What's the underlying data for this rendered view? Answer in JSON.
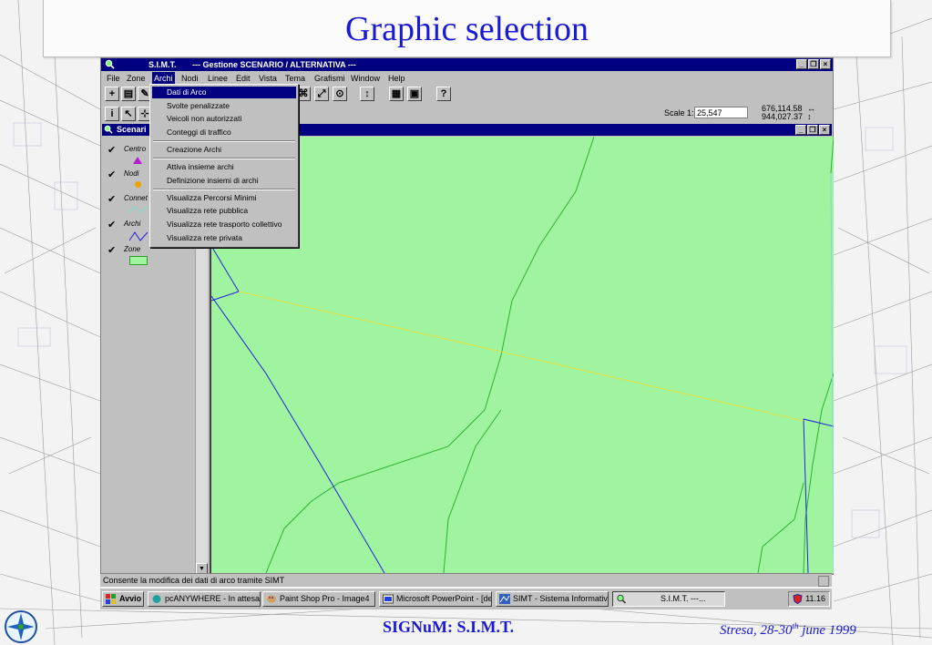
{
  "slide": {
    "title": "Graphic selection",
    "footer_center": "SIGNuM: S.I.M.T.",
    "footer_place_date_pre": "Stresa, 28-30",
    "footer_place_date_sup": "th",
    "footer_place_date_post": " june 1999"
  },
  "window": {
    "app_name": "S.I.M.T.",
    "title": "--- Gestione SCENARIO / ALTERNATIVA ---",
    "min": "_",
    "max": "❐",
    "close": "×"
  },
  "menu": [
    {
      "label": "File"
    },
    {
      "label": "Zone"
    },
    {
      "label": "Archi"
    },
    {
      "label": "Nodi"
    },
    {
      "label": "Linee"
    },
    {
      "label": "Edit"
    },
    {
      "label": "Vista"
    },
    {
      "label": "Tema"
    },
    {
      "label": "Grafismi"
    },
    {
      "label": "Window"
    },
    {
      "label": "Help"
    }
  ],
  "scale": {
    "label": "Scale 1:",
    "value": "25,547",
    "coord_x": "676,114.58",
    "coord_y": "944,027.37",
    "arrow_x": "↔",
    "arrow_y": "↕"
  },
  "child_window": {
    "title": "Scenari"
  },
  "legend": [
    {
      "label": "Centro"
    },
    {
      "label": "Nodi"
    },
    {
      "label": "Connet"
    },
    {
      "label": "Archi"
    },
    {
      "label": "Zone"
    }
  ],
  "legend_check": "✔",
  "archi_menu": {
    "items": [
      {
        "label": "Dati di Arco"
      },
      {
        "label": "Svolte penalizzate"
      },
      {
        "label": "Veicoli non autorizzati"
      },
      {
        "label": "Conteggi di traffico"
      },
      {
        "label": "Creazione Archi"
      },
      {
        "label": "Attiva insieme archi"
      },
      {
        "label": "Definizione insiemi di archi"
      },
      {
        "label": "Visualizza Percorsi Minimi"
      },
      {
        "label": "Visualizza rete pubblica"
      },
      {
        "label": "Visualizza rete trasporto collettivo"
      },
      {
        "label": "Visualizza rete privata"
      }
    ]
  },
  "status": {
    "text": "Consente la modifica dei dati di arco tramite SIMT"
  },
  "taskbar": {
    "start": "Avvio",
    "tasks": [
      {
        "label": "pcANYWHERE - In attesa..."
      },
      {
        "label": "Paint Shop Pro - Image4"
      },
      {
        "label": "Microsoft PowerPoint - [de..."
      },
      {
        "label": "SIMT - Sistema Informativo..."
      },
      {
        "label": "S.I.M.T.    ---..."
      }
    ],
    "clock": "11.16"
  },
  "colors": {
    "title_blue": "#1a1ad6",
    "map_green": "#a0f4a0",
    "win_navy": "#000080"
  }
}
